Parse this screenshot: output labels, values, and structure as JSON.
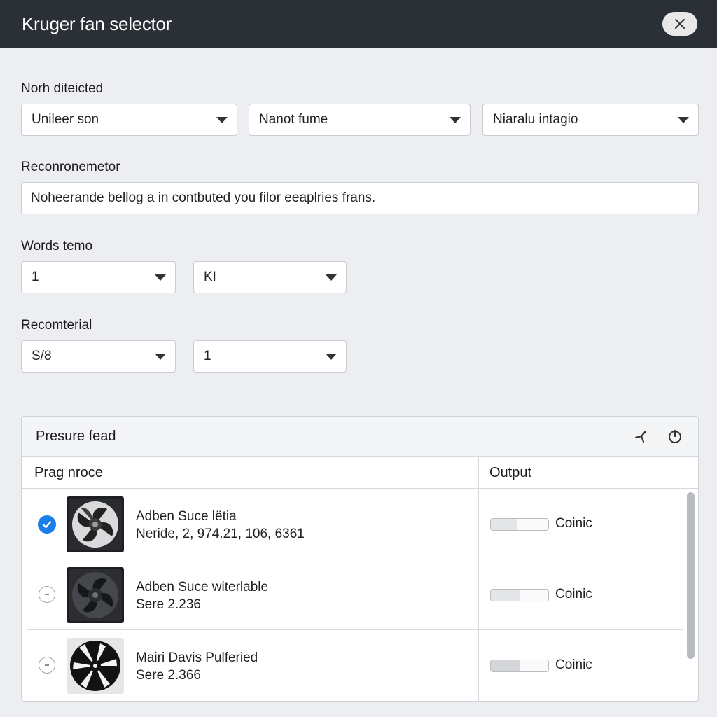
{
  "window": {
    "title": "Kruger fan selector",
    "close_icon": "close-icon"
  },
  "section1": {
    "label": "Norh diteicted",
    "selects": [
      "Unileer son",
      "Nanot fume",
      "Niaralu intagio"
    ]
  },
  "section2": {
    "label": "Reconronemetor",
    "value": "Noheerande bellog a in contbuted you filor eeaplries frans."
  },
  "section3": {
    "label": "Words temo",
    "selects": [
      "1",
      "KI"
    ]
  },
  "section4": {
    "label": "Recomterial",
    "selects": [
      "S/8",
      "1"
    ]
  },
  "panel": {
    "title": "Presure fead",
    "icons": [
      "fan-icon",
      "power-icon"
    ],
    "columns": [
      "Prag nroce",
      "Output"
    ],
    "rows": [
      {
        "checked": true,
        "name": "Adben Suce lëtia",
        "spec": "Neride, 2, 974.21, 106, 6361",
        "output_label": "Coinic",
        "output_fill": 0.45
      },
      {
        "checked": false,
        "name": "Adben Suce witerlable",
        "spec": "Sere 2.236",
        "output_label": "Coinic",
        "output_fill": 0.5
      },
      {
        "checked": false,
        "name": "Mairi Davis Pulferied",
        "spec": "Sere 2.366",
        "output_label": "Coinic",
        "output_fill": 0.5
      }
    ]
  },
  "colors": {
    "titlebar": "#2b2f36",
    "accent": "#1a7fe8",
    "background": "#eceef1"
  }
}
